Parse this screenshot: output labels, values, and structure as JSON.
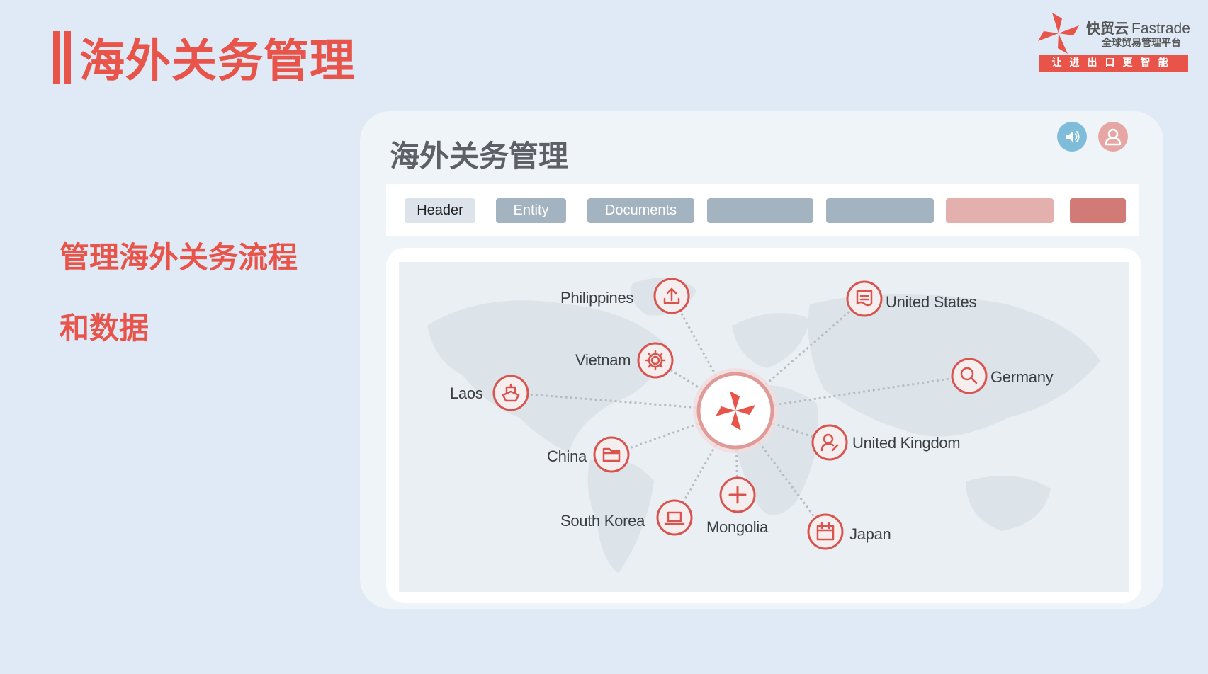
{
  "slide": {
    "title": "海外关务管理",
    "tagline_line1": "管理海外关务流程",
    "tagline_line2": "和数据"
  },
  "logo": {
    "brand_cn": "快贸云",
    "brand_en": "Fastrade",
    "subtitle": "全球贸易管理平台",
    "slogan": "让进出口更智能"
  },
  "card": {
    "title": "海外关务管理",
    "sound_icon": "speaker-icon",
    "user_icon": "user-icon"
  },
  "tabs": [
    {
      "label": "Header",
      "state": "active"
    },
    {
      "label": "Entity",
      "state": "normal"
    },
    {
      "label": "Documents",
      "state": "normal"
    },
    {
      "label": "",
      "state": "normal"
    },
    {
      "label": "",
      "state": "normal"
    },
    {
      "label": "",
      "state": "light-accent"
    },
    {
      "label": "",
      "state": "accent"
    }
  ],
  "map": {
    "hub_icon": "fastrade-logo-icon",
    "nodes": [
      {
        "country": "Philippines",
        "icon": "upload-icon"
      },
      {
        "country": "United States",
        "icon": "document-icon"
      },
      {
        "country": "Vietnam",
        "icon": "gear-icon"
      },
      {
        "country": "Laos",
        "icon": "ship-icon"
      },
      {
        "country": "Germany",
        "icon": "search-icon"
      },
      {
        "country": "China",
        "icon": "folder-icon"
      },
      {
        "country": "United Kingdom",
        "icon": "user-edit-icon"
      },
      {
        "country": "South Korea",
        "icon": "laptop-icon"
      },
      {
        "country": "Mongolia",
        "icon": "plus-icon"
      },
      {
        "country": "Japan",
        "icon": "calendar-icon"
      }
    ]
  },
  "colors": {
    "accent": "#e8534a",
    "background": "#dfeaf6",
    "tab_active": "#dde3ea",
    "tab_normal": "#a4b3c0",
    "tab_light_accent": "#e3b0ae",
    "tab_accent": "#d27b76",
    "speaker_bg": "#7fbcd9",
    "user_bg": "#e6a7a4"
  }
}
